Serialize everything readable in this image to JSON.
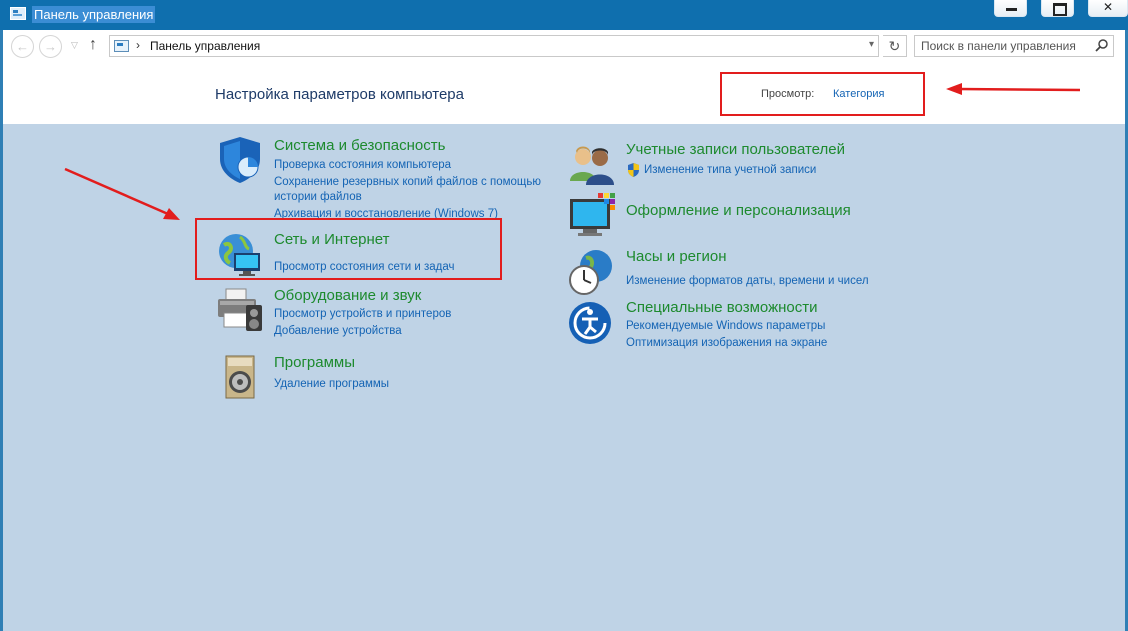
{
  "window": {
    "title": "Панель управления"
  },
  "addressbar": {
    "path": "Панель управления",
    "search_placeholder": "Поиск в панели управления"
  },
  "header": {
    "heading": "Настройка параметров компьютера",
    "view_label": "Просмотр:",
    "view_value": "Категория"
  },
  "categories": {
    "system": {
      "title": "Система и безопасность",
      "links": [
        "Проверка состояния компьютера",
        "Сохранение резервных копий файлов с помощью",
        "истории файлов",
        "Архивация и восстановление (Windows 7)"
      ],
      "icon": "shield-icon"
    },
    "network": {
      "title": "Сеть и Интернет",
      "links": [
        "Просмотр состояния сети и задач"
      ],
      "icon": "globe-network-icon"
    },
    "hardware": {
      "title": "Оборудование и звук",
      "links": [
        "Просмотр устройств и принтеров",
        "Добавление устройства"
      ],
      "icon": "printer-icon"
    },
    "programs": {
      "title": "Программы",
      "links": [
        "Удаление программы"
      ],
      "icon": "programs-disc-icon"
    },
    "users": {
      "title": "Учетные записи пользователей",
      "links": [
        "Изменение типа учетной записи"
      ],
      "icon": "users-icon"
    },
    "appearance": {
      "title": "Оформление и персонализация",
      "links": [],
      "icon": "monitor-palette-icon"
    },
    "clock": {
      "title": "Часы и регион",
      "links": [
        "Изменение форматов даты, времени и чисел"
      ],
      "icon": "clock-globe-icon"
    },
    "access": {
      "title": "Специальные возможности",
      "links": [
        "Рекомендуемые Windows параметры",
        "Оптимизация изображения на экране"
      ],
      "icon": "ease-of-access-icon"
    }
  },
  "colors": {
    "category_title": "#1d8a2e",
    "link": "#1464b4",
    "annotation": "#e21d1d",
    "content_bg": "#bfd3e6",
    "titlebar": "#0f6fae"
  }
}
